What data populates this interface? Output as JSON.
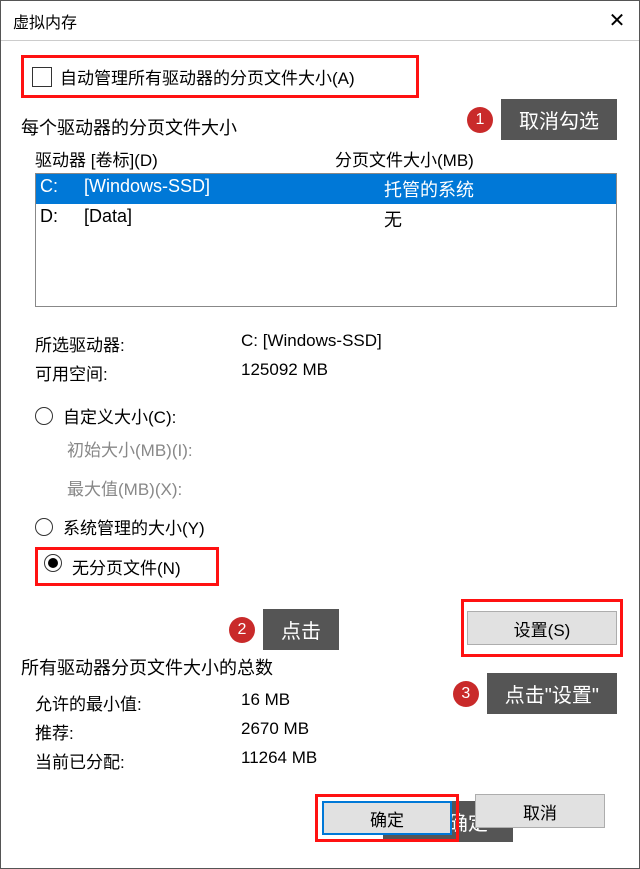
{
  "window": {
    "title": "虚拟内存"
  },
  "autoManage": {
    "label": "自动管理所有驱动器的分页文件大小(A)",
    "checked": false
  },
  "section": {
    "perDrive": "每个驱动器的分页文件大小"
  },
  "driveHeader": {
    "col1": "驱动器 [卷标](D)",
    "col2": "分页文件大小(MB)"
  },
  "drives": [
    {
      "letter": "C:",
      "label": "[Windows-SSD]",
      "size": "托管的系统",
      "selected": true
    },
    {
      "letter": "D:",
      "label": "[Data]",
      "size": "无",
      "selected": false
    }
  ],
  "selected": {
    "driveLabel": "所选驱动器:",
    "driveValue": "C:  [Windows-SSD]",
    "spaceLabel": "可用空间:",
    "spaceValue": "125092 MB"
  },
  "radios": {
    "custom": "自定义大小(C):",
    "initial": "初始大小(MB)(I):",
    "max": "最大值(MB)(X):",
    "system": "系统管理的大小(Y)",
    "none": "无分页文件(N)"
  },
  "setBtn": "设置(S)",
  "totals": {
    "header": "所有驱动器分页文件大小的总数",
    "minLabel": "允许的最小值:",
    "minValue": "16 MB",
    "recLabel": "推荐:",
    "recValue": "2670 MB",
    "curLabel": "当前已分配:",
    "curValue": "11264 MB"
  },
  "buttons": {
    "ok": "确定",
    "cancel": "取消"
  },
  "callouts": {
    "c1": "取消勾选",
    "c2": "点击",
    "c3": "点击\"设置\"",
    "c4": "点击\"确定\""
  }
}
